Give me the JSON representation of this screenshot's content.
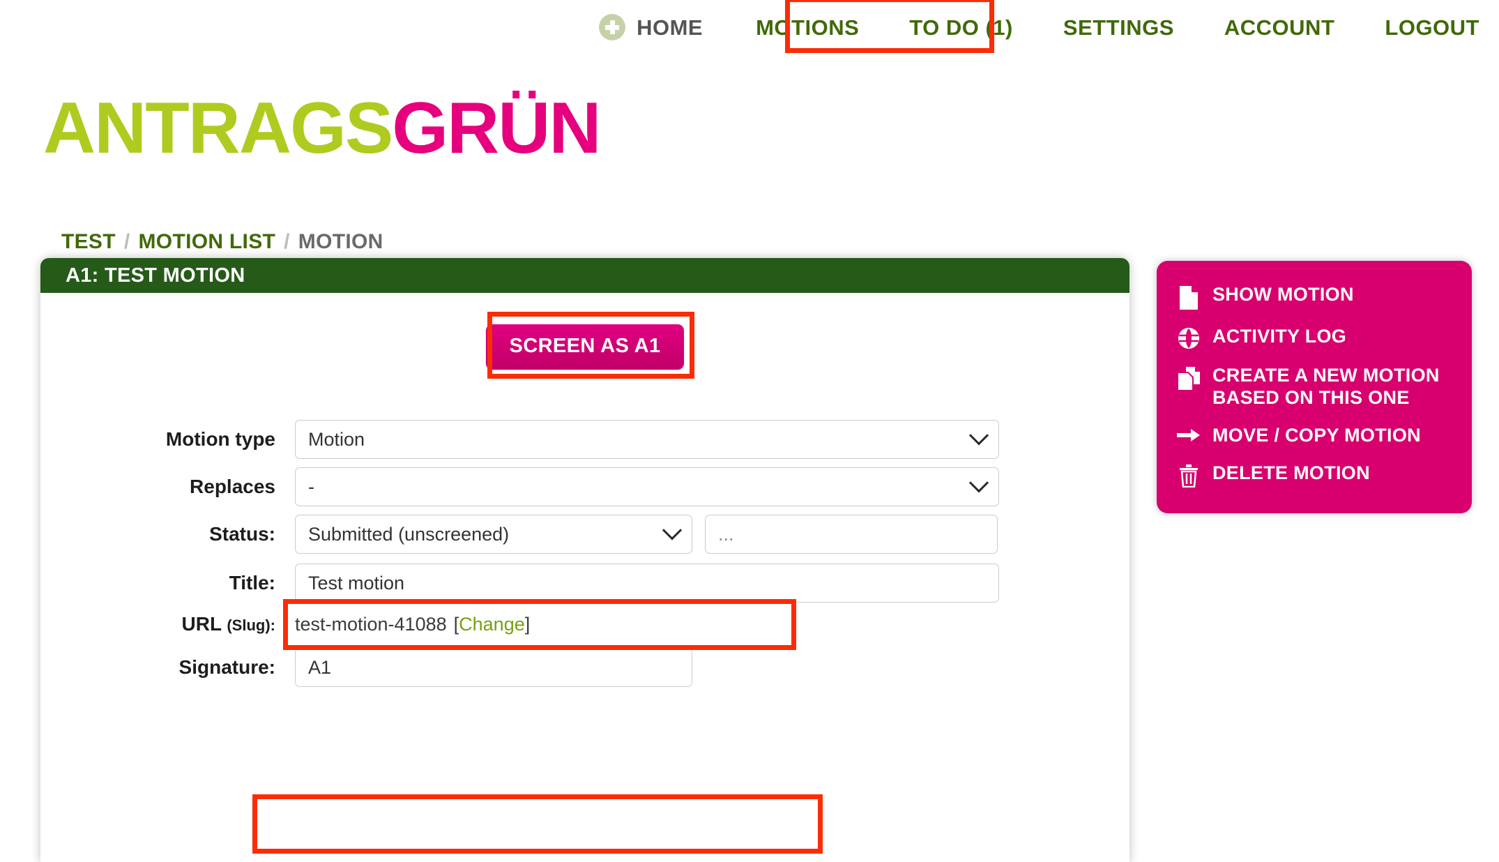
{
  "topnav": {
    "home": {
      "label": "Home",
      "icon": "plus-circle-icon"
    },
    "items": [
      {
        "label": "Motions",
        "name": "motions"
      },
      {
        "label": "To Do (1)",
        "name": "to-do"
      },
      {
        "label": "Settings",
        "name": "settings"
      },
      {
        "label": "Account",
        "name": "account"
      },
      {
        "label": "Logout",
        "name": "logout"
      }
    ]
  },
  "logo": {
    "part1": "ANTRAGS",
    "part2": "GRÜN"
  },
  "breadcrumb": {
    "items": [
      "TEST",
      "MOTION LIST",
      "MOTION"
    ],
    "separator": "/"
  },
  "panel": {
    "title": "A1: Test motion",
    "screen_button": "Screen as A1"
  },
  "form": {
    "motion_type": {
      "label": "Motion type",
      "value": "Motion"
    },
    "replaces": {
      "label": "Replaces",
      "value": "-"
    },
    "status": {
      "label": "Status:",
      "value": "Submitted (unscreened)",
      "note_placeholder": "..."
    },
    "title": {
      "label": "Title:",
      "value": "Test motion"
    },
    "url_slug": {
      "label": "URL",
      "label_small": "(Slug):",
      "value": "test-motion-41088",
      "change_open": "[",
      "change_label": "Change",
      "change_close": "]"
    },
    "signature": {
      "label": "Signature:",
      "value": "A1"
    }
  },
  "sidebar": {
    "items": [
      {
        "label": "Show motion",
        "icon": "document-icon"
      },
      {
        "label": "Activity log",
        "icon": "globe-icon"
      },
      {
        "label": "Create a new motion based on this one",
        "icon": "copy-document-icon"
      },
      {
        "label": "Move / copy motion",
        "icon": "arrow-right-icon"
      },
      {
        "label": "Delete motion",
        "icon": "trash-icon"
      }
    ]
  },
  "colors": {
    "nav_green": "#41690a",
    "panel_green": "#255a18",
    "pink": "#d8006e",
    "logo_green": "#b0cb1f",
    "logo_pink": "#e6007e",
    "highlight_red": "#fb2c06",
    "link_green": "#76a10f"
  }
}
